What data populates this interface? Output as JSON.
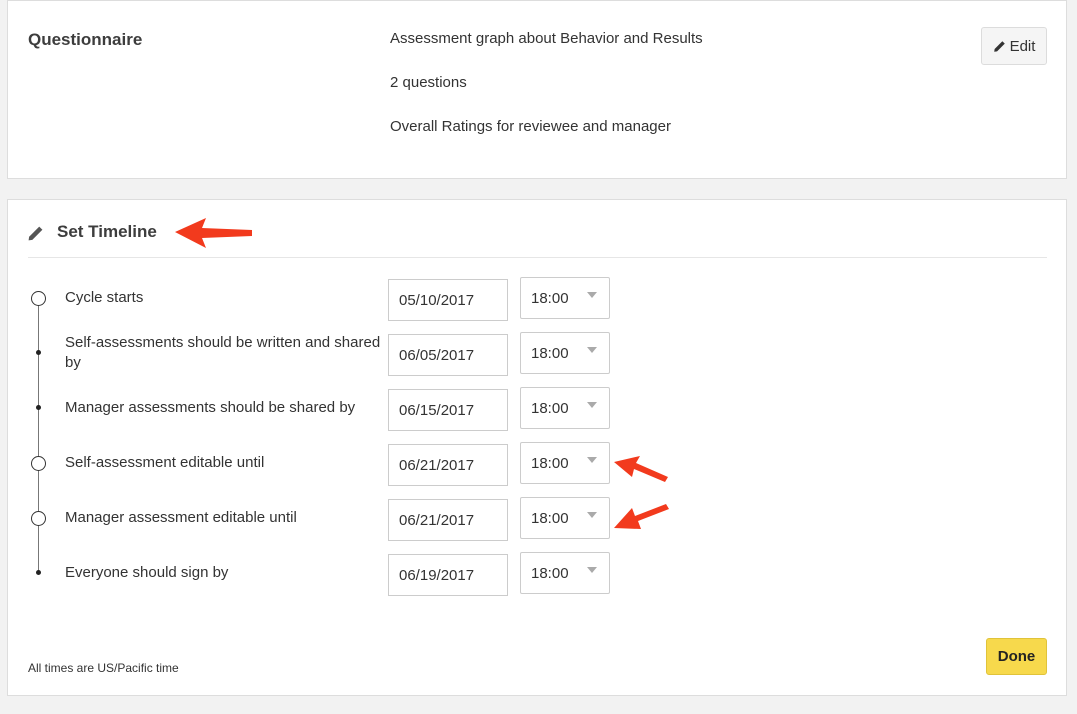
{
  "questionnaire": {
    "title": "Questionnaire",
    "lines": [
      "Assessment graph about Behavior and Results",
      "2 questions",
      "Overall Ratings for reviewee and manager"
    ],
    "edit_label": "Edit"
  },
  "timeline": {
    "title": "Set Timeline",
    "rows": [
      {
        "label": "Cycle starts",
        "date": "05/10/2017",
        "time": "18:00",
        "marker": "circle"
      },
      {
        "label": "Self-assessments should be written and shared by",
        "date": "06/05/2017",
        "time": "18:00",
        "marker": "dot"
      },
      {
        "label": "Manager assessments should be shared by",
        "date": "06/15/2017",
        "time": "18:00",
        "marker": "dot"
      },
      {
        "label": "Self-assessment editable until",
        "date": "06/21/2017",
        "time": "18:00",
        "marker": "circle"
      },
      {
        "label": "Manager assessment editable until",
        "date": "06/21/2017",
        "time": "18:00",
        "marker": "circle"
      },
      {
        "label": "Everyone should sign by",
        "date": "06/19/2017",
        "time": "18:00",
        "marker": "dot"
      }
    ],
    "footnote": "All times are US/Pacific time",
    "done_label": "Done"
  },
  "icons": {
    "edit": "pencil-icon",
    "timeline_header": "pencil-icon",
    "time_caret": "caret-down-icon"
  },
  "colors": {
    "done_button": "#f7d94c",
    "annotation_arrow": "#f23a1d"
  }
}
